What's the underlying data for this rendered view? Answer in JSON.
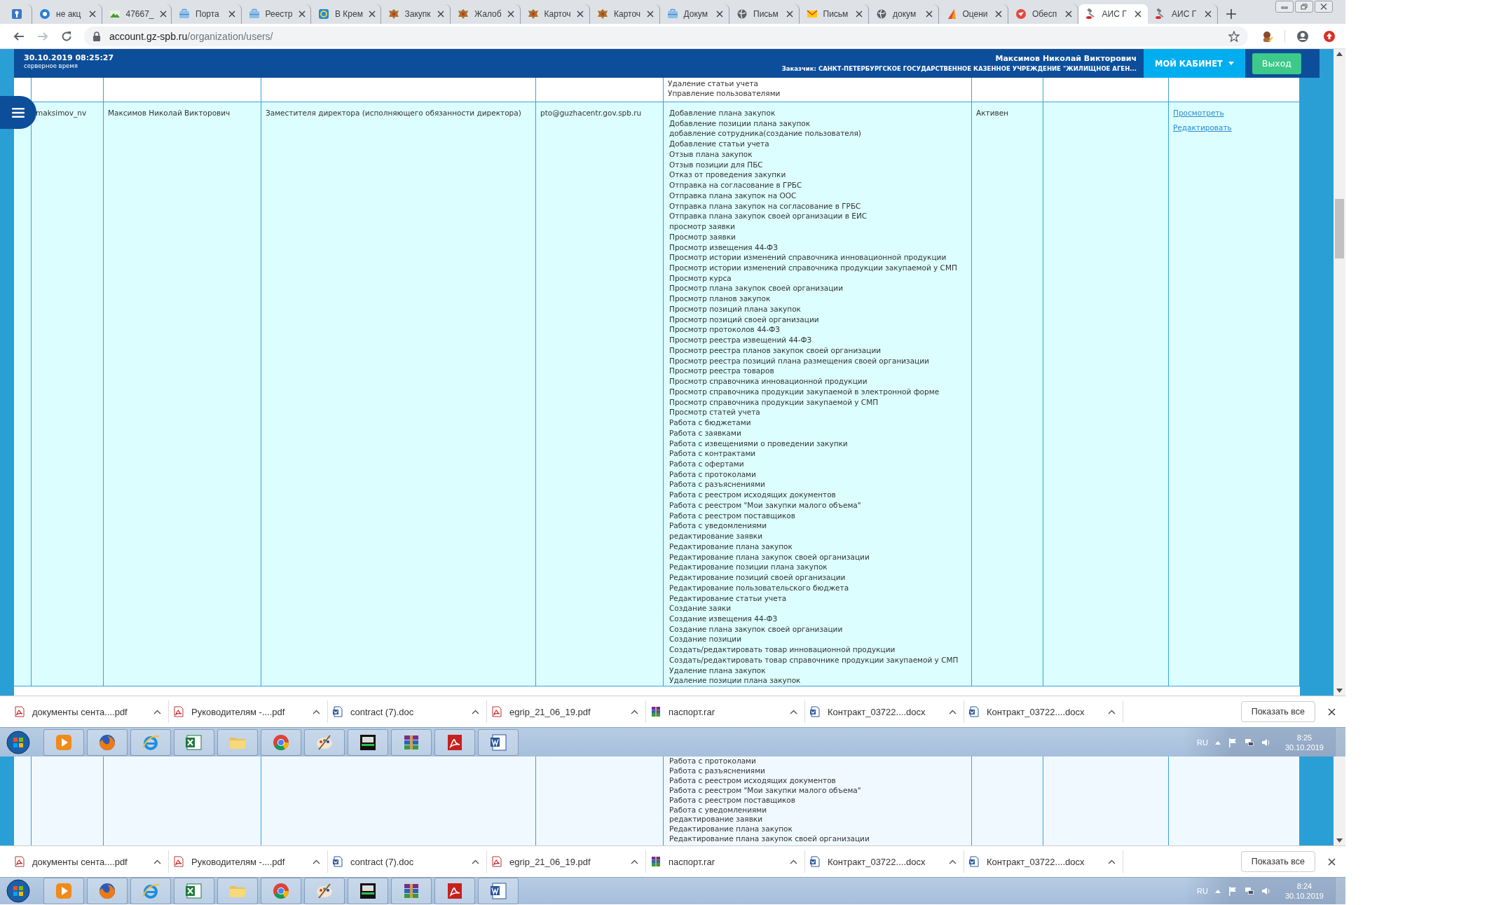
{
  "browser": {
    "tabs": [
      {
        "kind": "app",
        "selected": false
      },
      {
        "kind": "help-globe",
        "title": "не акц",
        "selected": false
      },
      {
        "kind": "landscape",
        "title": "47667_",
        "selected": false
      },
      {
        "kind": "briefcase",
        "title": "Порта",
        "selected": false
      },
      {
        "kind": "briefcase",
        "title": "Реестр",
        "selected": false
      },
      {
        "kind": "at",
        "title": "В Крем",
        "selected": false
      },
      {
        "kind": "emblem",
        "title": "Закупк",
        "selected": false
      },
      {
        "kind": "emblem",
        "title": "Жалоб",
        "selected": false
      },
      {
        "kind": "emblem",
        "title": "Карточ",
        "selected": false
      },
      {
        "kind": "emblem",
        "title": "Карточ",
        "selected": false
      },
      {
        "kind": "briefcase",
        "title": "Докум",
        "selected": false
      },
      {
        "kind": "globe",
        "title": "Письм",
        "selected": false
      },
      {
        "kind": "mail",
        "title": "Письм",
        "selected": false
      },
      {
        "kind": "globe",
        "title": "докум",
        "selected": false
      },
      {
        "kind": "triangle",
        "title": "Оцени",
        "selected": false
      },
      {
        "kind": "red-circle",
        "title": "Обесп",
        "selected": false
      },
      {
        "kind": "gavel",
        "title": "АИС Г",
        "selected": true
      },
      {
        "kind": "gavel",
        "title": "АИС Г",
        "selected": false
      }
    ],
    "address": {
      "host": "account.gz-spb.ru",
      "path": "/organization/users/"
    }
  },
  "header": {
    "datetime": "30.10.2019 08:25:27",
    "datetime_caption": "серверное время",
    "user": "Максимов Николай Викторович",
    "customer": "Заказчик: САНКТ-ПЕТЕРБУРГСКОЕ ГОСУДАРСТВЕННОЕ КАЗЕННОЕ УЧРЕЖДЕНИЕ \"ЖИЛИЩНОЕ АГЕН...",
    "cabinet_button": "МОЙ КАБИНЕТ",
    "logout_button": "Выход"
  },
  "table": {
    "previous_row": {
      "permissions": [
        "Удаление статьи учета",
        "Управление пользователями"
      ]
    },
    "row": {
      "highlighted": true,
      "login": "maksimov_nv",
      "name": "Максимов Николай Викторович",
      "position": "Заместителя директора (исполняющего обязанности директора)",
      "email": "pto@guzhacentr.gov.spb.ru",
      "status": "Активен",
      "actions": [
        "Просмотреть",
        "Редактировать"
      ],
      "permissions": [
        "Добавление плана закупок",
        "Добавление позиции плана закупок",
        "добавление сотрудника(создание пользователя)",
        "Добавление статьи учета",
        "Отзыв плана закупок",
        "Отзыв позиции для ПБС",
        "Отказ от проведения закупки",
        "Отправка на согласование в ГРБС",
        "Отправка плана закупок на ООС",
        "Отправка плана закупок на согласование в ГРБС",
        "Отправка плана закупок своей организации в ЕИС",
        "просмотр заявки",
        "Просмотр заявки",
        "Просмотр извещения 44-ФЗ",
        "Просмотр истории изменений справочника инновационной продукции",
        "Просмотр истории изменений справочника продукции закупаемой у СМП",
        "Просмотр курса",
        "Просмотр плана закупок своей организации",
        "Просмотр планов закупок",
        "Просмотр позиций плана закупок",
        "Просмотр позиций своей организации",
        "Просмотр протоколов 44-ФЗ",
        "Просмотр реестра извещений 44-ФЗ",
        "Просмотр реестра планов закупок своей организации",
        "Просмотр реестра позиций плана размещения своей организации",
        "Просмотр реестра товаров",
        "Просмотр справочника инновационной продукции",
        "Просмотр справочника продукции закупаемой в электронной форме",
        "Просмотр справочника продукции закупаемой у СМП",
        "Просмотр статей учета",
        "Работа с бюджетами",
        "Работа с заявками",
        "Работа с извещениями о проведении закупки",
        "Работа с контрактами",
        "Работа с офертами",
        "Работа с протоколами",
        "Работа с разъяснениями",
        "Работа с реестром исходящих документов",
        "Работа с реестром \"Мои закупки малого объема\"",
        "Работа с реестром поставщиков",
        "Работа с уведомлениями",
        "редактирование заявки",
        "Редактирование плана закупок",
        "Редактирование плана закупок своей организации",
        "Редактирование позиции плана закупок",
        "Редактирование позиций своей организации",
        "Редактирование пользовательского бюджета",
        "Редактирование статьи учета",
        "Создание заяки",
        "Создание извещения 44-ФЗ",
        "Создание плана закупок своей организации",
        "Создание позиции",
        "Создать/редактировать товар инновационной продукции",
        "Создать/редактировать товар справочнике продукции закупаемой у СМП",
        "Удаление плана закупок",
        "Удаление позиции плана закупок"
      ]
    }
  },
  "downloads": {
    "items": [
      {
        "kind": "pdf",
        "name": "документы сента....pdf"
      },
      {
        "kind": "pdf",
        "name": "Руководителям -....pdf"
      },
      {
        "kind": "doc",
        "name": "contract (7).doc"
      },
      {
        "kind": "pdf",
        "name": "egrip_21_06_19.pdf"
      },
      {
        "kind": "rar",
        "name": "паспорт.rar"
      },
      {
        "kind": "doc",
        "name": "Контракт_03722....docx"
      },
      {
        "kind": "doc",
        "name": "Контракт_03722....docx"
      }
    ],
    "show_all": "Показать все"
  },
  "taskbar": {
    "apps": [
      {
        "kind": "media"
      },
      {
        "kind": "firefox"
      },
      {
        "kind": "ie"
      },
      {
        "kind": "excel"
      },
      {
        "kind": "explorer"
      },
      {
        "kind": "chrome"
      },
      {
        "kind": "paint"
      },
      {
        "kind": "pdf-tool"
      },
      {
        "kind": "winrar"
      },
      {
        "kind": "acrobat"
      },
      {
        "kind": "word"
      }
    ],
    "language": "RU",
    "time": "8:25",
    "date": "30.10.2019"
  },
  "second_capture": {
    "row": {
      "highlighted": false,
      "permissions": [
        "Работа с протоколами",
        "Работа с разъяснениями",
        "Работа с реестром исходящих документов",
        "Работа с реестром \"Мои закупки малого объема\"",
        "Работа с реестром поставщиков",
        "Работа с уведомлениями",
        "редактирование заявки",
        "Редактирование плана закупок",
        "Редактирование плана закупок своей организации"
      ]
    },
    "downloads": {
      "items": [
        {
          "kind": "pdf",
          "name": "документы сента....pdf"
        },
        {
          "kind": "pdf",
          "name": "Руководителям -....pdf"
        },
        {
          "kind": "doc",
          "name": "contract (7).doc"
        },
        {
          "kind": "pdf",
          "name": "egrip_21_06_19.pdf"
        },
        {
          "kind": "rar",
          "name": "паспорт.rar"
        },
        {
          "kind": "doc",
          "name": "Контракт_03722....docx"
        },
        {
          "kind": "doc",
          "name": "Контракт_03722....docx"
        }
      ],
      "show_all": "Показать все"
    },
    "taskbar": {
      "apps": [
        {
          "kind": "media"
        },
        {
          "kind": "firefox"
        },
        {
          "kind": "ie"
        },
        {
          "kind": "excel"
        },
        {
          "kind": "explorer"
        },
        {
          "kind": "chrome"
        },
        {
          "kind": "paint"
        },
        {
          "kind": "pdf-tool"
        },
        {
          "kind": "winrar"
        },
        {
          "kind": "acrobat"
        },
        {
          "kind": "word"
        }
      ],
      "language": "RU",
      "time": "8:24",
      "date": "30.10.2019"
    }
  }
}
